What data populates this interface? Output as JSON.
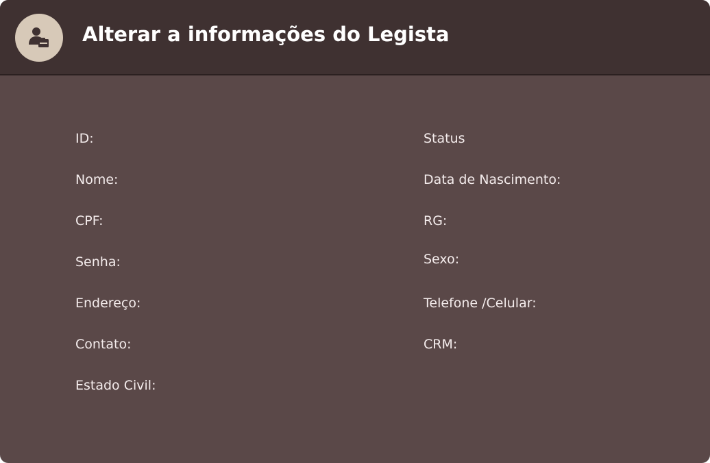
{
  "header": {
    "title": "Alterar a informações do Legista",
    "avatar_icon": "user-id-badge-icon"
  },
  "form": {
    "left_fields": [
      "ID:",
      "Nome:",
      "CPF:",
      "Senha:",
      "Endereço:",
      "Contato:",
      "Estado Civil:"
    ],
    "right_fields": [
      "Status",
      "Data de Nascimento:",
      "RG:",
      "Sexo:",
      "Telefone /Celular:",
      "CRM:"
    ]
  },
  "colors": {
    "header_bg": "#3f3131",
    "body_bg": "#5a4848",
    "avatar_bg": "#d7c9b8",
    "text": "#f4ecec"
  }
}
